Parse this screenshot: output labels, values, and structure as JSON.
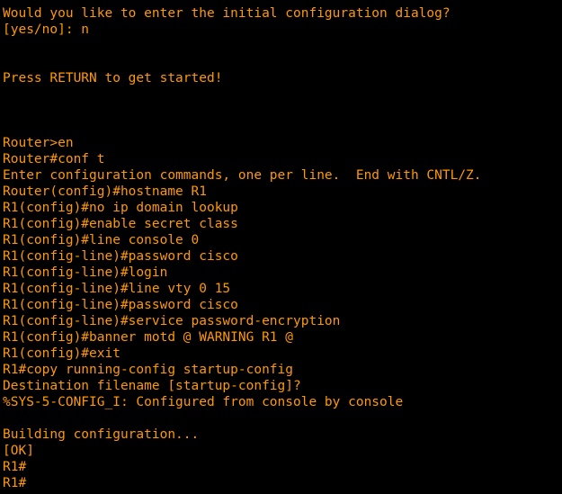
{
  "terminal": {
    "colors": {
      "background": "#000000",
      "foreground": "#ff9900"
    },
    "lines": [
      "Would you like to enter the initial configuration dialog?",
      "[yes/no]: n",
      "",
      "",
      "Press RETURN to get started!",
      "",
      "",
      "",
      "Router>en",
      "Router#conf t",
      "Enter configuration commands, one per line.  End with CNTL/Z.",
      "Router(config)#hostname R1",
      "R1(config)#no ip domain lookup",
      "R1(config)#enable secret class",
      "R1(config)#line console 0",
      "R1(config-line)#password cisco",
      "R1(config-line)#login",
      "R1(config-line)#line vty 0 15",
      "R1(config-line)#password cisco",
      "R1(config-line)#service password-encryption",
      "R1(config)#banner motd @ WARNING R1 @",
      "R1(config)#exit",
      "R1#copy running-config startup-config",
      "Destination filename [startup-config]?",
      "%SYS-5-CONFIG_I: Configured from console by console",
      "",
      "Building configuration...",
      "[OK]",
      "R1#",
      "R1#"
    ]
  }
}
